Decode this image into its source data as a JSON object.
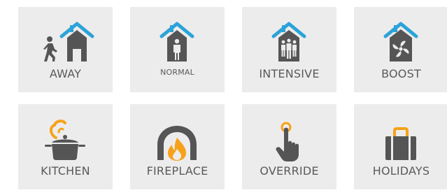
{
  "tiles": {
    "away": {
      "label": "AWAY"
    },
    "normal": {
      "label": "NORMAL"
    },
    "intensive": {
      "label": "INTENSIVE"
    },
    "boost": {
      "label": "BOOST"
    },
    "kitchen": {
      "label": "KITCHEN"
    },
    "fireplace": {
      "label": "FIREPLACE"
    },
    "override": {
      "label": "OVERRIDE"
    },
    "holidays": {
      "label": "HOLIDAYS"
    }
  },
  "colors": {
    "tile_background": "#ececec",
    "icon_gray": "#555555",
    "accent_blue": "#2ba3d9",
    "accent_orange": "#f7a11a",
    "label_text": "#5a5a5a"
  },
  "icons": {
    "away": "walking-person-house-icon",
    "normal": "person-house-icon",
    "intensive": "group-house-icon",
    "boost": "fan-house-icon",
    "kitchen": "cooking-pot-icon",
    "fireplace": "fireplace-flame-icon",
    "override": "pointing-hand-icon",
    "holidays": "suitcase-icon"
  }
}
